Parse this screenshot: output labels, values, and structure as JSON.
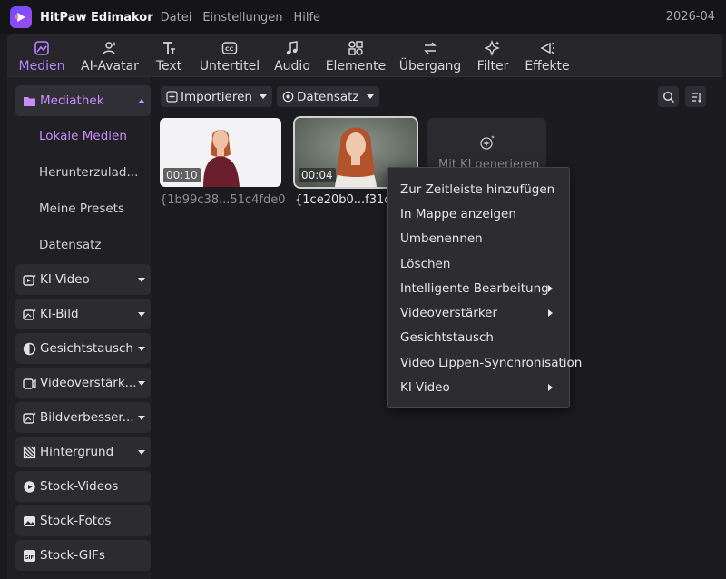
{
  "app": {
    "title": "HitPaw Edimakor",
    "clock": "2026-04"
  },
  "menu": [
    "Datei",
    "Einstellungen",
    "Hilfe"
  ],
  "toolbar": [
    {
      "label": "Medien",
      "icon": "media-icon",
      "active": true
    },
    {
      "label": "AI-Avatar",
      "icon": "avatar-icon"
    },
    {
      "label": "Text",
      "icon": "text-icon"
    },
    {
      "label": "Untertitel",
      "icon": "subtitle-icon"
    },
    {
      "label": "Audio",
      "icon": "audio-icon"
    },
    {
      "label": "Elemente",
      "icon": "elements-icon"
    },
    {
      "label": "Übergang",
      "icon": "transition-icon"
    },
    {
      "label": "Filter",
      "icon": "filter-icon"
    },
    {
      "label": "Effekte",
      "icon": "effects-icon"
    }
  ],
  "sidebar": {
    "mediathek": "Mediathek",
    "sub": [
      "Lokale Medien",
      "Herunterzulad...",
      "Meine Presets",
      "Datensatz"
    ],
    "items": [
      "KI-Video",
      "KI-Bild",
      "Gesichtstausch",
      "Videoverstärk...",
      "Bildverbesser...",
      "Hintergrund",
      "Stock-Videos",
      "Stock-Fotos",
      "Stock-GIFs"
    ]
  },
  "main": {
    "import_label": "Importieren",
    "dataset_label": "Datensatz",
    "media": [
      {
        "duration": "00:10",
        "name": "{1b99c38...51c4fde0"
      },
      {
        "duration": "00:04",
        "name": "{1ce20b0...f31dba"
      }
    ],
    "generate_label": "Mit KI generieren"
  },
  "context_menu": [
    {
      "label": "Zur Zeitleiste hinzufügen"
    },
    {
      "label": "In Mappe anzeigen"
    },
    {
      "label": "Umbenennen"
    },
    {
      "label": "Löschen"
    },
    {
      "label": "Intelligente Bearbeitung"
    },
    {
      "label": "Videoverstärker"
    },
    {
      "label": "Gesichtstausch"
    },
    {
      "label": "Video Lippen-Synchronisation"
    },
    {
      "label": "KI-Video"
    }
  ],
  "colors": {
    "accent": "#b882ff",
    "background": "#1b1b1f",
    "panel": "#26262b"
  }
}
